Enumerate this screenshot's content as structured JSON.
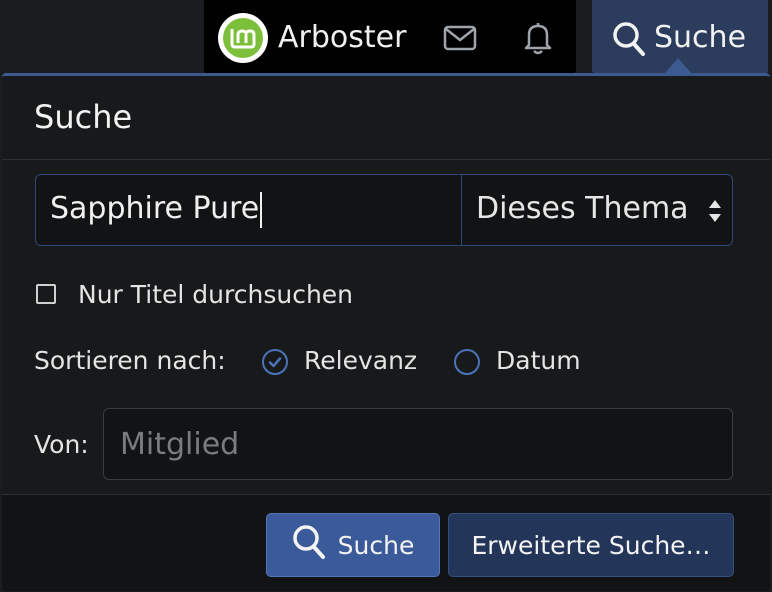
{
  "topnav": {
    "username": "Arboster",
    "search_tab_label": "Suche",
    "icons": [
      "envelope-icon",
      "bell-icon",
      "search-icon"
    ]
  },
  "menu": {
    "title": "Suche",
    "query_value": "Sapphire Pure",
    "scope_selected": "Dieses Thema",
    "title_only_label": "Nur Titel durchsuchen",
    "title_only_checked": false,
    "sort_label": "Sortieren nach:",
    "sort_options": [
      {
        "label": "Relevanz",
        "selected": true
      },
      {
        "label": "Datum",
        "selected": false
      }
    ],
    "from_label": "Von:",
    "from_placeholder": "Mitglied",
    "search_button": "Suche",
    "advanced_button": "Erweiterte Suche…"
  },
  "colors": {
    "accent": "#3b5a9a",
    "accent_border": "#4b74b8",
    "background": "#18191b"
  }
}
